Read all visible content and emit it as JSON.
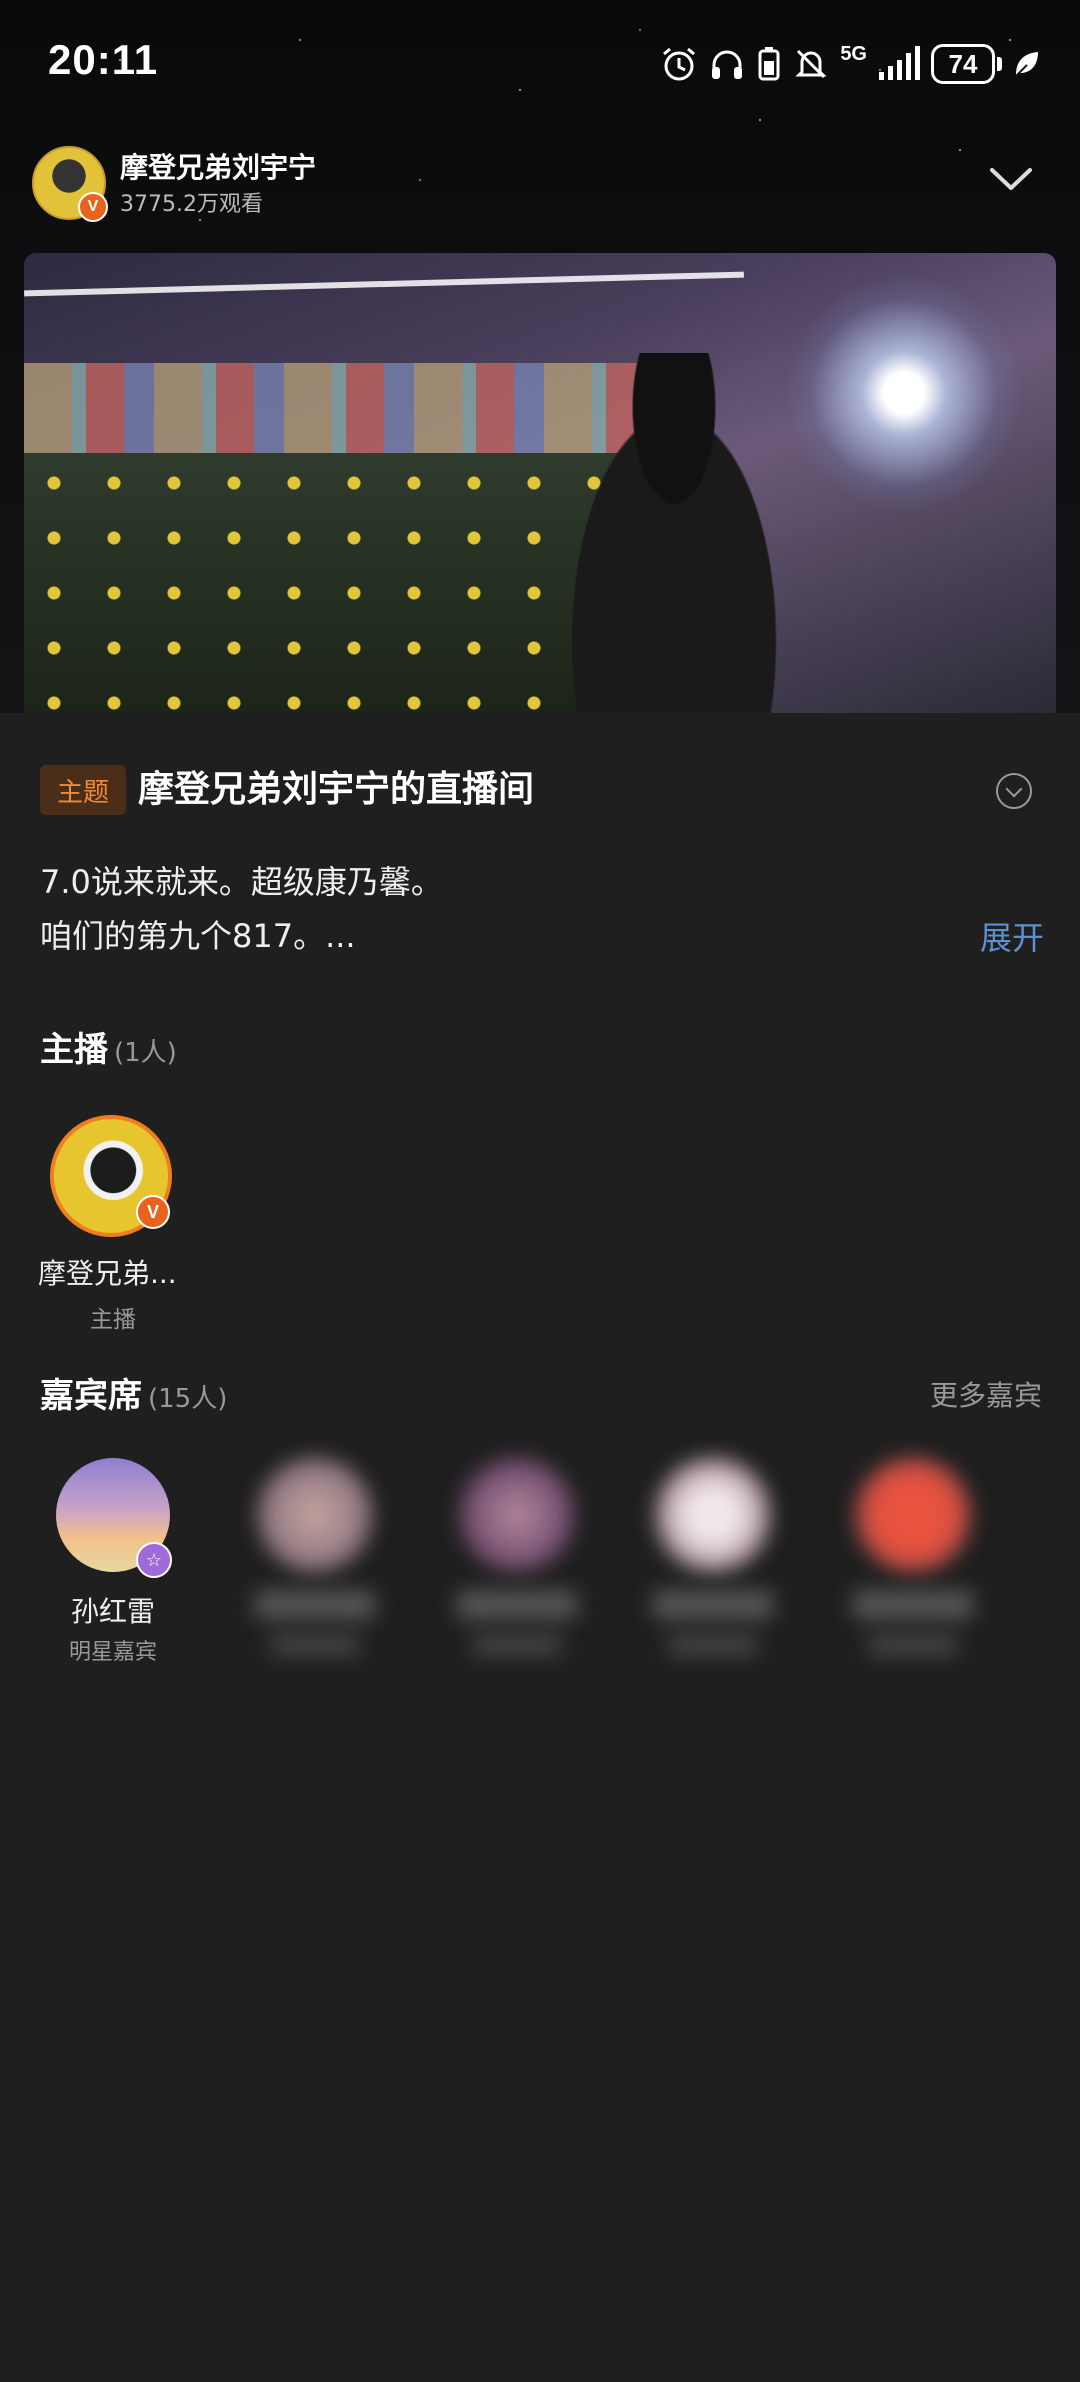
{
  "status_bar": {
    "time": "20:11",
    "battery": "74",
    "network": "5G"
  },
  "header": {
    "streamer_name": "摩登兄弟刘宇宁",
    "views": "3775.2万观看"
  },
  "topic": {
    "tag": "主题",
    "title": "摩登兄弟刘宇宁的直播间"
  },
  "description": {
    "line1": "7.0说来就来。超级康乃馨。",
    "line2": "咱们的第九个817。...",
    "expand_label": "展开"
  },
  "hosts": {
    "title": "主播",
    "count": "(1人)",
    "items": [
      {
        "name": "摩登兄弟...",
        "role": "主播",
        "verified": "V"
      }
    ]
  },
  "guests": {
    "title": "嘉宾席",
    "count": "(15人)",
    "more_label": "更多嘉宾",
    "items": [
      {
        "name": "孙红雷",
        "role": "明星嘉宾",
        "badge": "☆"
      }
    ]
  },
  "colors": {
    "accent_orange": "#f07d1e",
    "link_blue": "#5f8fcf",
    "sheet_bg": "#1f1f1f"
  }
}
